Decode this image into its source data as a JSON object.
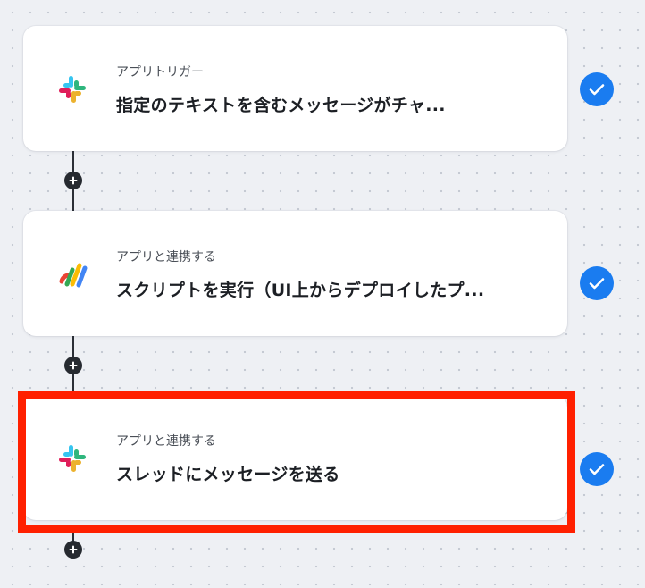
{
  "steps": [
    {
      "app": "slack",
      "icon": "slack-icon",
      "label": "アプリトリガー",
      "title": "指定のテキストを含むメッセージがチャ...",
      "status": "completed"
    },
    {
      "app": "google-apps-script",
      "icon": "google-apps-script-icon",
      "label": "アプリと連携する",
      "title": "スクリプトを実行（UI上からデプロイしたプ...",
      "status": "completed"
    },
    {
      "app": "slack",
      "icon": "slack-icon",
      "label": "アプリと連携する",
      "title": "スレッドにメッセージを送る",
      "status": "completed",
      "highlighted": true
    }
  ],
  "colors": {
    "check": "#1a7cf0",
    "highlight": "#ff2000",
    "connector": "#2b2f36",
    "background": "#eef0f4"
  },
  "icons": {
    "add_step": "plus-icon",
    "completed": "checkmark-icon"
  }
}
